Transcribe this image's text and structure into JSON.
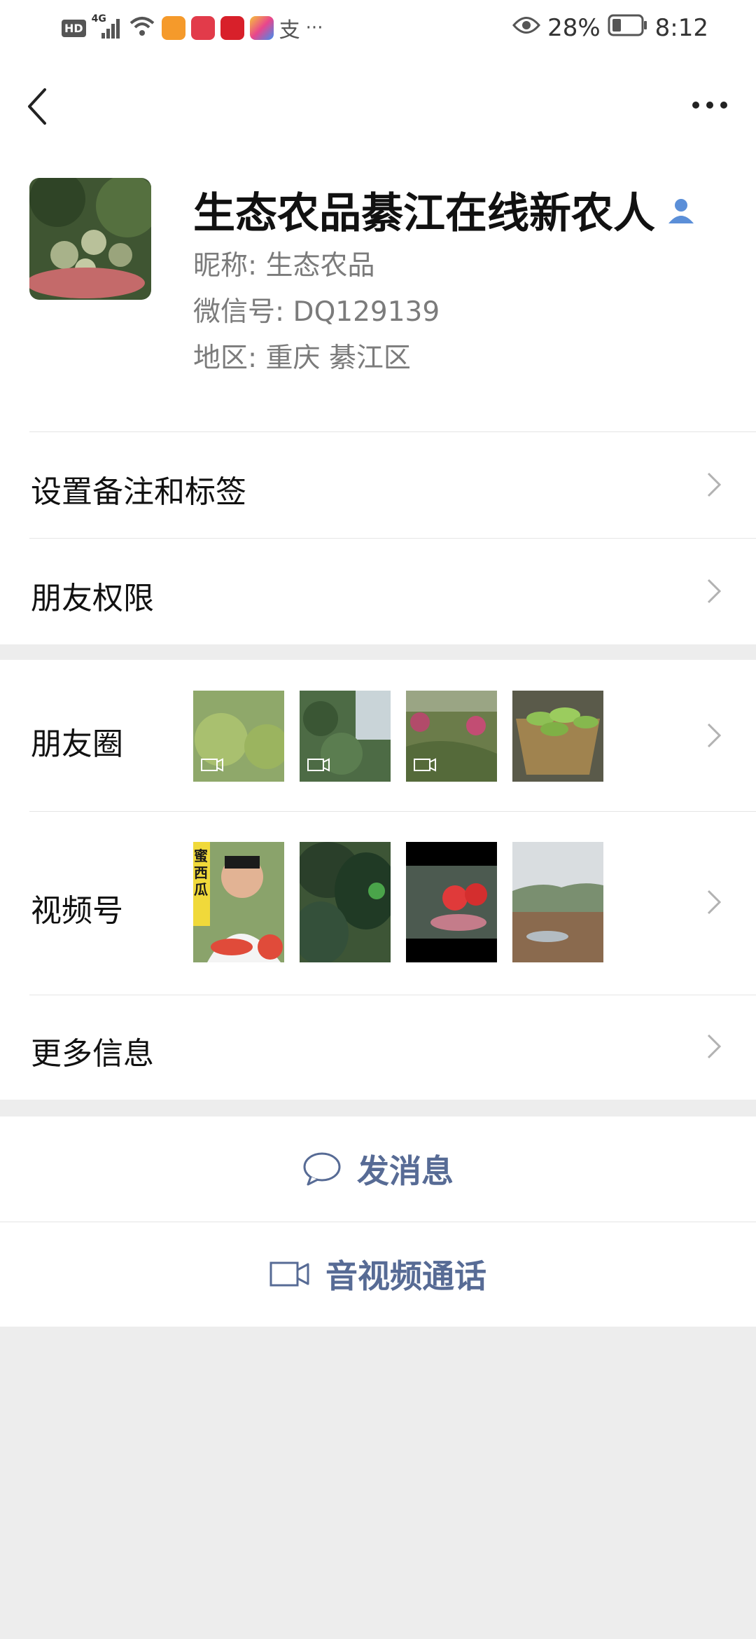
{
  "status": {
    "hd": "HD",
    "network": "4G",
    "battery_pct": "28%",
    "time": "8:12"
  },
  "profile": {
    "display_name": "生态农品綦江在线新农人",
    "nickname": "昵称:  生态农品",
    "wechat_id": "微信号:  DQ129139",
    "region": "地区:  重庆  綦江区"
  },
  "menu": {
    "remark": "设置备注和标签",
    "permission": "朋友权限",
    "moments": "朋友圈",
    "channels": "视频号",
    "more_info": "更多信息"
  },
  "channel_thumb_text": "蜜西瓜",
  "actions": {
    "message": "发消息",
    "call": "音视频通话"
  },
  "colors": {
    "link": "#576b95",
    "background": "#ededed",
    "verified_icon": "#5b8fd8"
  }
}
